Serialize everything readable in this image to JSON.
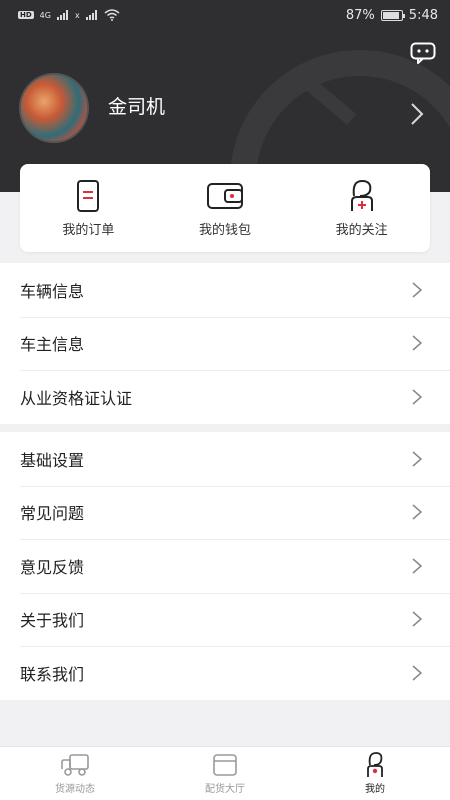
{
  "status_bar": {
    "left_icons": [
      "HD",
      "4G",
      "signal",
      "x",
      "signal",
      "wifi"
    ],
    "battery": "87%",
    "time": "5:48"
  },
  "header": {
    "driver_name": "金司机",
    "message_icon": "message-icon",
    "avatar": "avatar"
  },
  "quick_actions": [
    {
      "label": "我的订单",
      "icon": "order-icon"
    },
    {
      "label": "我的钱包",
      "icon": "wallet-icon"
    },
    {
      "label": "我的关注",
      "icon": "follow-icon"
    }
  ],
  "section1": [
    {
      "label": "车辆信息"
    },
    {
      "label": "车主信息"
    },
    {
      "label": "从业资格证认证"
    }
  ],
  "section2": [
    {
      "label": "基础设置"
    },
    {
      "label": "常见问题"
    },
    {
      "label": "意见反馈"
    },
    {
      "label": "关于我们"
    },
    {
      "label": "联系我们"
    }
  ],
  "tabs": [
    {
      "label": "货源动态",
      "icon": "truck-icon",
      "active": false
    },
    {
      "label": "配货大厅",
      "icon": "hall-icon",
      "active": false
    },
    {
      "label": "我的",
      "icon": "profile-icon",
      "active": true
    }
  ],
  "colors": {
    "header_bg": "#2f2f31",
    "accent_red": "#e02e3a"
  }
}
